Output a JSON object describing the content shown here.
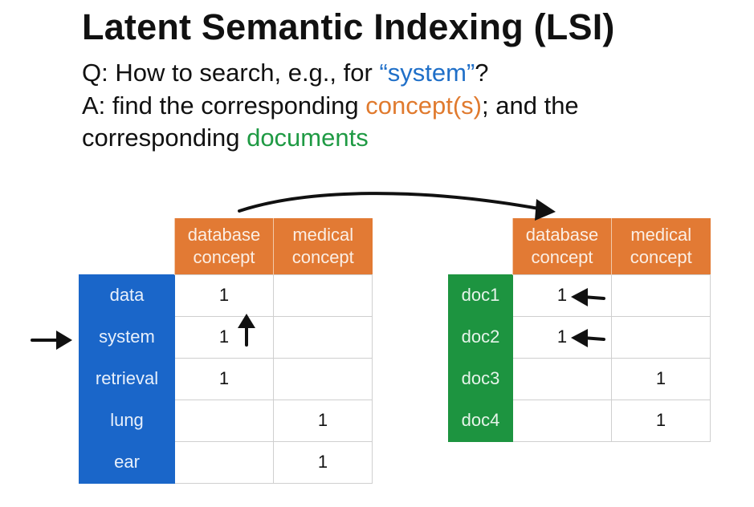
{
  "slide": {
    "title": "Latent Semantic Indexing (LSI)",
    "q_prefix": "Q: How to search, e.g., for ",
    "q_term": "“system”",
    "q_suffix": "?",
    "a_prefix": "A: find the corresponding ",
    "a_concepts": "concept(s)",
    "a_mid": "; and the",
    "a_line3_prefix": "corresponding ",
    "a_documents": "documents"
  },
  "term_table": {
    "col1": [
      "database",
      "concept"
    ],
    "col2": [
      "medical",
      "concept"
    ],
    "rows": [
      {
        "label": "data",
        "c1": "1",
        "c2": ""
      },
      {
        "label": "system",
        "c1": "1",
        "c2": ""
      },
      {
        "label": "retrieval",
        "c1": "1",
        "c2": ""
      },
      {
        "label": "lung",
        "c1": "",
        "c2": "1"
      },
      {
        "label": "ear",
        "c1": "",
        "c2": "1"
      }
    ]
  },
  "doc_table": {
    "col1": [
      "database",
      "concept"
    ],
    "col2": [
      "medical",
      "concept"
    ],
    "rows": [
      {
        "label": "doc1",
        "c1": "1",
        "c2": ""
      },
      {
        "label": "doc2",
        "c1": "1",
        "c2": ""
      },
      {
        "label": "doc3",
        "c1": "",
        "c2": "1"
      },
      {
        "label": "doc4",
        "c1": "",
        "c2": "1"
      }
    ]
  },
  "colors": {
    "row_label_blue": "#1a66c9",
    "row_label_green": "#1d9440",
    "header_orange": "#e27a34",
    "text_blue": "#1f6fc8",
    "text_orange": "#e07a2e",
    "text_green": "#1f9a44"
  },
  "icons": [
    "arrow-right-icon",
    "arrow-up-icon",
    "arrow-left-icon",
    "curved-arrow"
  ]
}
